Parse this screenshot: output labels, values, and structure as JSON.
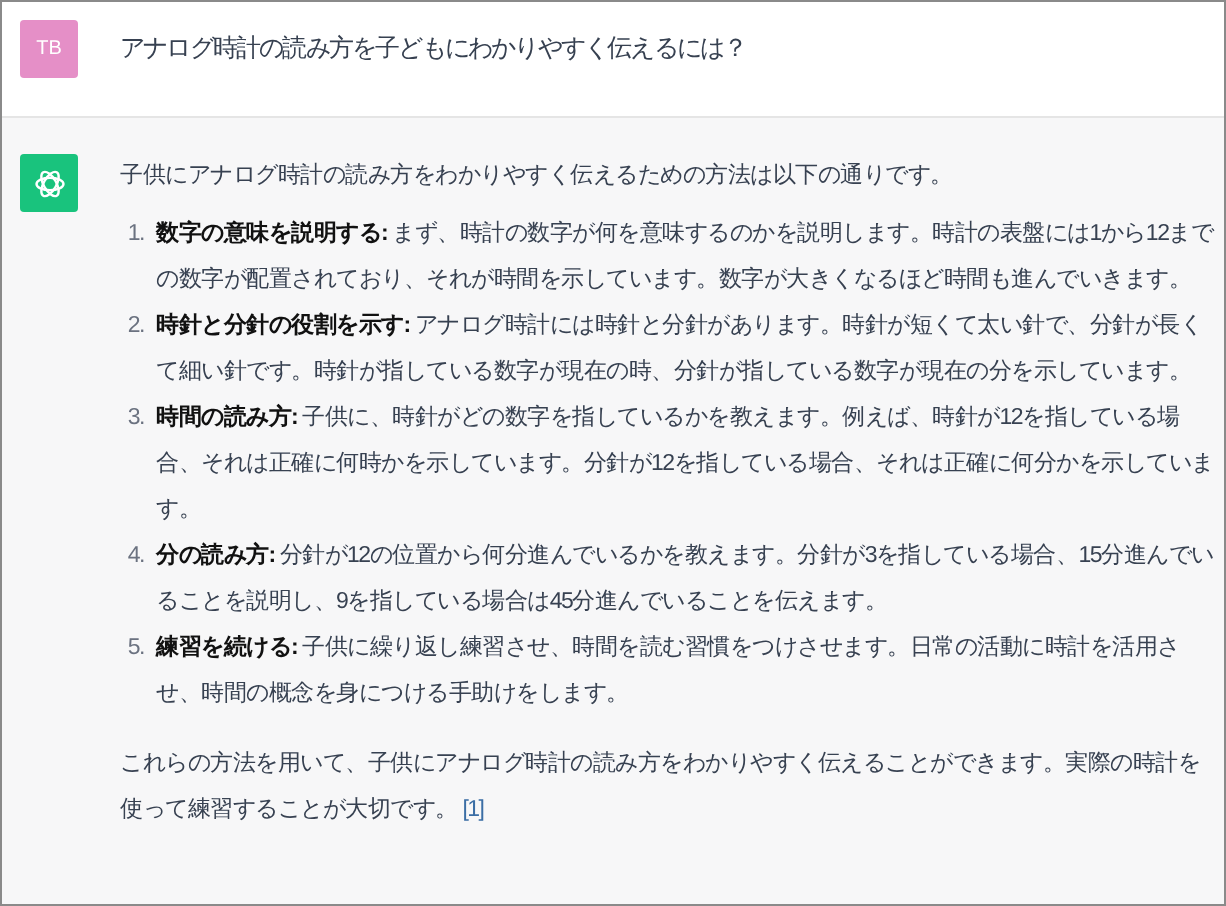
{
  "user_message": {
    "avatar": "TB",
    "text": "アナログ時計の読み方を子どもにわかりやすく伝えるには？"
  },
  "assistant_message": {
    "intro": "子供にアナログ時計の読み方をわかりやすく伝えるための方法は以下の通りです。",
    "steps": [
      {
        "number": "1.",
        "text": "**数字の意味を説明する:** まず、時計の数字が何を意味するのかを説明します。時計の表盤には1から12までの数字が配置されており、それが時間を示しています。数字が大きくなるほど時間も進んでいきます。"
      },
      {
        "number": "2.",
        "text": "**時針と分針の役割を示す:** アナログ時計には時針と分針があります。時針が短くて太い針で、分針が長くて細い針です。時針が指している数字が現在の時、分針が指している数字が現在の分を示しています。"
      },
      {
        "number": "3.",
        "text": "**時間の読み方:** 子供に、時針がどの数字を指しているかを教えます。例えば、時針が12を指している場合、それは正確に何時かを示しています。分針が12を指している場合、それは正確に何分かを示しています。"
      },
      {
        "number": "4.",
        "text": "**分の読み方:** 分針が12の位置から何分進んでいるかを教えます。分針が3を指している場合、15分進んでいることを説明し、9を指している場合は45分進んでいることを伝えます。"
      },
      {
        "number": "5.",
        "text": "**練習を続ける:** 子供に繰り返し練習させ、時間を読む習慣をつけさせます。日常の活動に時計を活用させ、時間の概念を身につける手助けをします。"
      }
    ],
    "conclusion": "これらの方法を用いて、子供にアナログ時計の読み方をわかりやすく伝えることができます。実際の時計を使って練習することが大切です。",
    "citation": "[1]"
  }
}
